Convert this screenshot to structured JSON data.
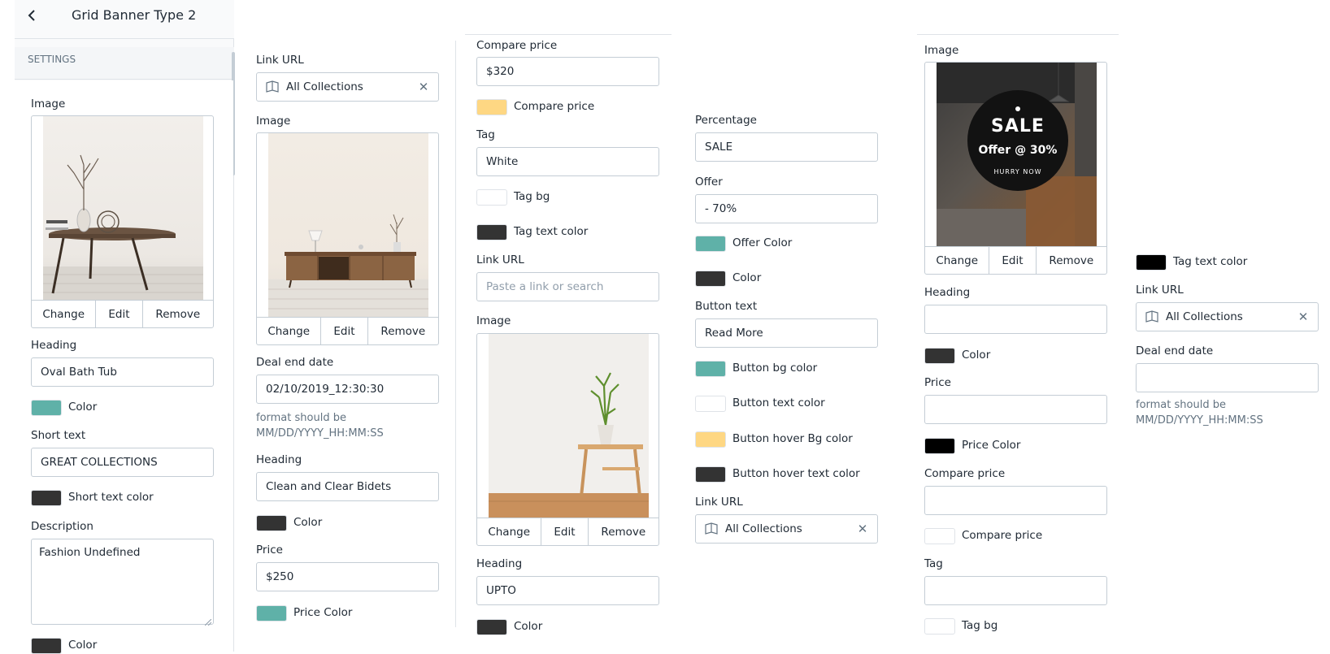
{
  "header": {
    "title": "Grid Banner Type 2",
    "section": "SETTINGS"
  },
  "colors": {
    "teal": "#5fb1a8",
    "dark": "#333333",
    "black": "#000000",
    "yellow": "#fed783",
    "white": "#ffffff"
  },
  "col1": {
    "image_label": "Image",
    "change": "Change",
    "edit": "Edit",
    "remove": "Remove",
    "heading_label": "Heading",
    "heading_value": "Oval Bath Tub",
    "color_label": "Color",
    "short_text_label": "Short text",
    "short_text_value": "GREAT COLLECTIONS",
    "short_text_color_label": "Short text color",
    "description_label": "Description",
    "description_value": "Fashion Undefined",
    "color2_label": "Color"
  },
  "col2": {
    "link_url_label": "Link URL",
    "link_url_value": "All Collections",
    "image_label": "Image",
    "change": "Change",
    "edit": "Edit",
    "remove": "Remove",
    "deal_end_label": "Deal end date",
    "deal_end_value": "02/10/2019_12:30:30",
    "format_hint": "format should be MM/DD/YYYY_HH:MM:SS",
    "heading_label": "Heading",
    "heading_value": "Clean and Clear Bidets",
    "color_label": "Color",
    "price_label": "Price",
    "price_value": "$250",
    "price_color_label": "Price Color"
  },
  "col3": {
    "compare_price_label": "Compare price",
    "compare_price_value": "$320",
    "compare_price_color_label": "Compare price",
    "tag_label": "Tag",
    "tag_value": "White",
    "tag_bg_label": "Tag bg",
    "tag_text_color_label": "Tag text color",
    "link_url_label": "Link URL",
    "link_url_placeholder": "Paste a link or search",
    "image_label": "Image",
    "change": "Change",
    "edit": "Edit",
    "remove": "Remove",
    "heading_label": "Heading",
    "heading_value": "UPTO",
    "color_label": "Color"
  },
  "col4": {
    "percentage_label": "Percentage",
    "percentage_value": "SALE",
    "offer_label": "Offer",
    "offer_value": "- 70%",
    "offer_color_label": "Offer Color",
    "color_label": "Color",
    "button_text_label": "Button text",
    "button_text_value": "Read More",
    "button_bg_label": "Button bg color",
    "button_text_color_label": "Button text color",
    "button_hover_bg_label": "Button hover Bg color",
    "button_hover_text_label": "Button hover text color",
    "link_url_label": "Link URL",
    "link_url_value": "All Collections"
  },
  "col5": {
    "image_label": "Image",
    "sale_title": "SALE",
    "sale_offer": "Offer @ 30%",
    "sale_hurry": "HURRY NOW",
    "change": "Change",
    "edit": "Edit",
    "remove": "Remove",
    "heading_label": "Heading",
    "heading_value": "",
    "color_label": "Color",
    "price_label": "Price",
    "price_value": "",
    "price_color_label": "Price Color",
    "compare_price_label": "Compare price",
    "compare_price_value": "",
    "compare_price_color_label": "Compare price",
    "tag_label": "Tag",
    "tag_value": "",
    "tag_bg_label": "Tag bg"
  },
  "col6": {
    "tag_text_color_label": "Tag text color",
    "link_url_label": "Link URL",
    "link_url_value": "All Collections",
    "deal_end_label": "Deal end date",
    "deal_end_value": "",
    "format_hint": "format should be MM/DD/YYYY_HH:MM:SS"
  }
}
